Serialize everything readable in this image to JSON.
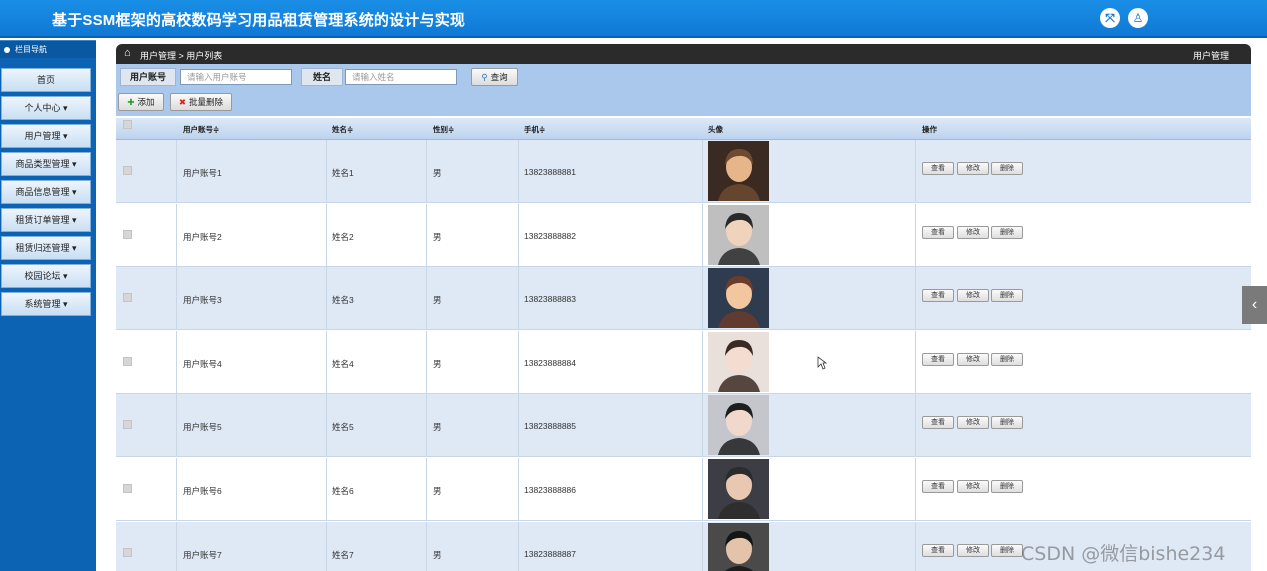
{
  "header": {
    "title": "基于SSM框架的高校数码学习用品租赁管理系统的设计与实现",
    "fullscreen_icon": "expand-icon",
    "user_icon": "user-icon"
  },
  "sidebar": {
    "nav_title": "栏目导航",
    "items": [
      {
        "label": "首页"
      },
      {
        "label": "个人中心 ▾"
      },
      {
        "label": "用户管理 ▾"
      },
      {
        "label": "商品类型管理 ▾"
      },
      {
        "label": "商品信息管理 ▾"
      },
      {
        "label": "租赁订单管理 ▾"
      },
      {
        "label": "租赁归还管理 ▾"
      },
      {
        "label": "校园论坛 ▾"
      },
      {
        "label": "系统管理 ▾"
      }
    ]
  },
  "breadcrumb": {
    "path": "用户管理 > 用户列表",
    "right_title": "用户管理"
  },
  "search": {
    "account_label": "用户账号",
    "account_placeholder": "请输入用户账号",
    "name_label": "姓名",
    "name_placeholder": "请输入姓名",
    "query_button": "查询",
    "add_button": "添加",
    "batch_delete_button": "批量删除"
  },
  "table": {
    "columns": [
      "用户账号≑",
      "姓名≑",
      "性别≑",
      "手机≑",
      "头像",
      "操作"
    ],
    "actions": {
      "view": "查看",
      "edit": "修改",
      "delete": "删除"
    },
    "rows": [
      {
        "account": "用户账号1",
        "name": "姓名1",
        "gender": "男",
        "phone": "13823888881"
      },
      {
        "account": "用户账号2",
        "name": "姓名2",
        "gender": "男",
        "phone": "13823888882"
      },
      {
        "account": "用户账号3",
        "name": "姓名3",
        "gender": "男",
        "phone": "13823888883"
      },
      {
        "account": "用户账号4",
        "name": "姓名4",
        "gender": "男",
        "phone": "13823888884"
      },
      {
        "account": "用户账号5",
        "name": "姓名5",
        "gender": "男",
        "phone": "13823888885"
      },
      {
        "account": "用户账号6",
        "name": "姓名6",
        "gender": "男",
        "phone": "13823888886"
      },
      {
        "account": "用户账号7",
        "name": "姓名7",
        "gender": "男",
        "phone": "13823888887"
      }
    ]
  },
  "watermark": "CSDN @微信bishe234",
  "colors": {
    "header_blue": "#1a8fe6",
    "sidebar_blue": "#0c63b4",
    "search_bg": "#a9c8ec",
    "row_alt": "#dfe8f5"
  }
}
